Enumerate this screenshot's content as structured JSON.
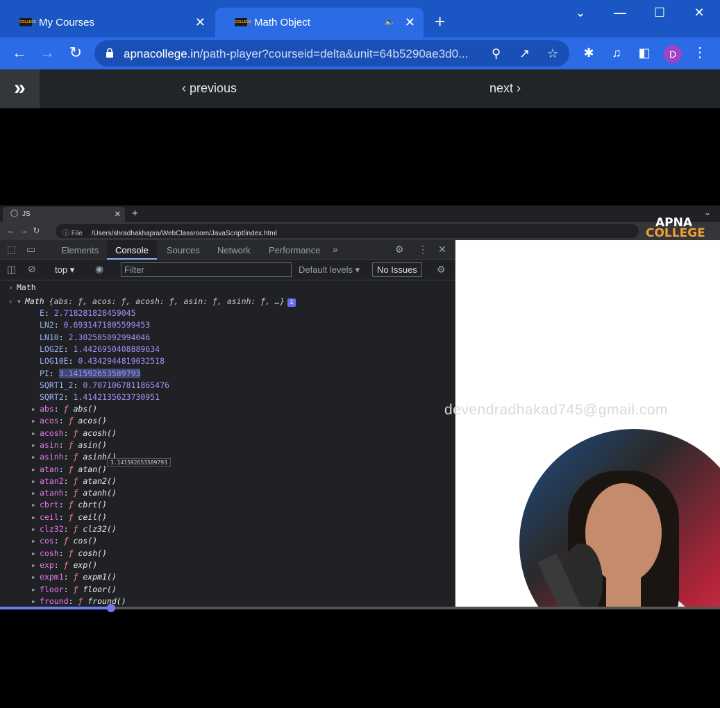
{
  "browser": {
    "tabs": [
      {
        "title": "My Courses",
        "close": "✕"
      },
      {
        "title": "Math Object",
        "close": "✕"
      }
    ],
    "new_tab": "+",
    "url_host": "apnacollege.in",
    "url_path": "/path-player?courseid=delta&unit=64b5290ae3d0...",
    "profile_initial": "D"
  },
  "site": {
    "previous_label": "previous",
    "next_label": "next"
  },
  "video": {
    "inner_tab_title": "JS",
    "inner_file_label": "File",
    "inner_url": "/Users/shradhakhapra/WebClassroom/JavaScript/index.html",
    "brand_line1": "APNA",
    "brand_line2": "COLLEGE",
    "watermark": "devendradhakad745@gmail.com",
    "progress": 0.154
  },
  "devtools": {
    "tabs": [
      "Elements",
      "Console",
      "Sources",
      "Network",
      "Performance"
    ],
    "active_tab": "Console",
    "context": "top",
    "filter_placeholder": "Filter",
    "levels": "Default levels",
    "issues": "No Issues",
    "input_line": "Math",
    "result_label": "Math",
    "result_summary": "{abs: ƒ, acos: ƒ, acosh: ƒ, asin: ƒ, asinh: ƒ, …}",
    "info_badge": "i",
    "constants": [
      {
        "key": "E",
        "value": "2.718281828459045"
      },
      {
        "key": "LN2",
        "value": "0.6931471805599453"
      },
      {
        "key": "LN10",
        "value": "2.302585092994046"
      },
      {
        "key": "LOG2E",
        "value": "1.4426950408889634"
      },
      {
        "key": "LOG10E",
        "value": "0.4342944819032518"
      },
      {
        "key": "PI",
        "value": "3.141592653589793"
      },
      {
        "key": "SQRT1_2",
        "value": "0.7071067811865476"
      },
      {
        "key": "SQRT2",
        "value": "1.4142135623730951"
      }
    ],
    "tooltip": "3.141592653589793",
    "functions": [
      {
        "key": "abs",
        "value": "abs()"
      },
      {
        "key": "acos",
        "value": "acos()"
      },
      {
        "key": "acosh",
        "value": "acosh()"
      },
      {
        "key": "asin",
        "value": "asin()"
      },
      {
        "key": "asinh",
        "value": "asinh()"
      },
      {
        "key": "atan",
        "value": "atan()"
      },
      {
        "key": "atan2",
        "value": "atan2()"
      },
      {
        "key": "atanh",
        "value": "atanh()"
      },
      {
        "key": "cbrt",
        "value": "cbrt()"
      },
      {
        "key": "ceil",
        "value": "ceil()"
      },
      {
        "key": "clz32",
        "value": "clz32()"
      },
      {
        "key": "cos",
        "value": "cos()"
      },
      {
        "key": "cosh",
        "value": "cosh()"
      },
      {
        "key": "exp",
        "value": "exp()"
      },
      {
        "key": "expm1",
        "value": "expm1()"
      },
      {
        "key": "floor",
        "value": "floor()"
      },
      {
        "key": "fround",
        "value": "fround()"
      }
    ]
  }
}
